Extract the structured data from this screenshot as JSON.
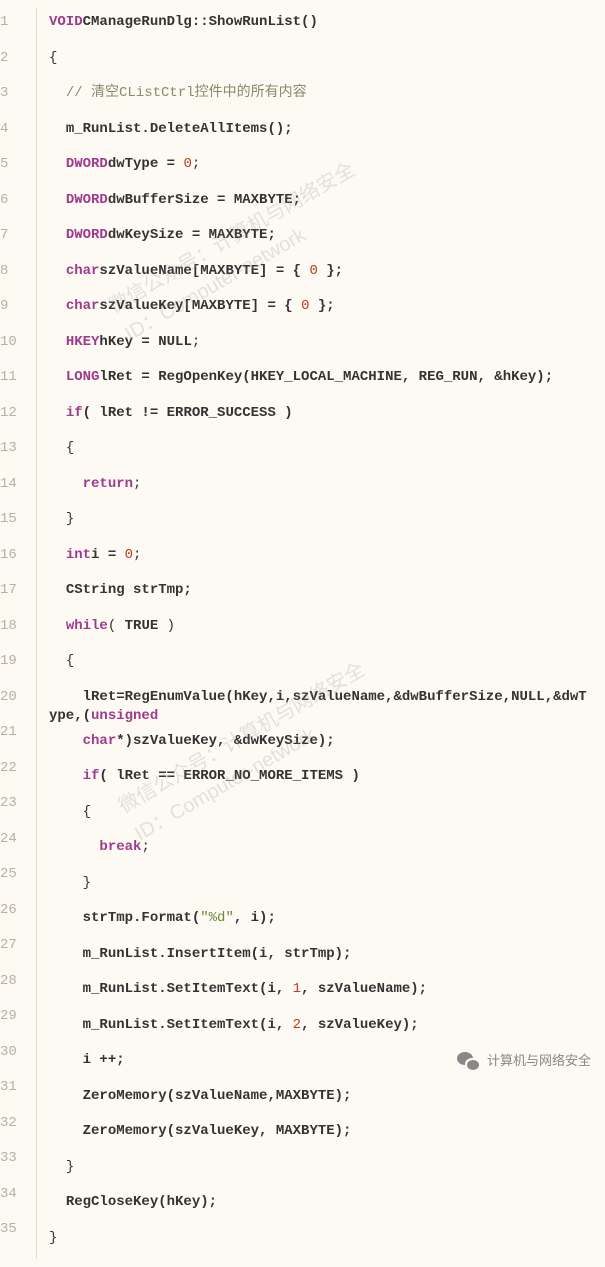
{
  "watermark": {
    "line1": "微信公众号：计算机与网络安全",
    "line2": "ID：Computer-network"
  },
  "footer": "计算机与网络安全",
  "code": {
    "lines": [
      {
        "n": "1",
        "indent": 0,
        "tokens": [
          {
            "t": "VOID",
            "c": "type"
          },
          {
            "t": "CManageRunDlg::ShowRunList()",
            "c": "ident"
          }
        ]
      },
      {
        "n": "2",
        "indent": 0,
        "tokens": [
          {
            "t": "{",
            "c": "punc"
          }
        ]
      },
      {
        "n": "3",
        "indent": 1,
        "tokens": [
          {
            "t": "// 清空CListCtrl控件中的所有内容",
            "c": "comment"
          }
        ]
      },
      {
        "n": "4",
        "indent": 1,
        "tokens": [
          {
            "t": "m_RunList.DeleteAllItems();",
            "c": "ident"
          }
        ]
      },
      {
        "n": "5",
        "indent": 1,
        "tokens": [
          {
            "t": "DWORD",
            "c": "type"
          },
          {
            "t": "dwType = ",
            "c": "ident"
          },
          {
            "t": "0",
            "c": "num"
          },
          {
            "t": ";",
            "c": "punc"
          }
        ]
      },
      {
        "n": "6",
        "indent": 1,
        "tokens": [
          {
            "t": "DWORD",
            "c": "type"
          },
          {
            "t": "dwBufferSize = MAXBYTE;",
            "c": "ident"
          }
        ]
      },
      {
        "n": "7",
        "indent": 1,
        "tokens": [
          {
            "t": "DWORD",
            "c": "type"
          },
          {
            "t": "dwKeySize = MAXBYTE;",
            "c": "ident"
          }
        ]
      },
      {
        "n": "8",
        "indent": 1,
        "tokens": [
          {
            "t": "char",
            "c": "type"
          },
          {
            "t": "szValueName[MAXBYTE] = { ",
            "c": "ident"
          },
          {
            "t": "0",
            "c": "num"
          },
          {
            "t": " };",
            "c": "ident"
          }
        ]
      },
      {
        "n": "9",
        "indent": 1,
        "tokens": [
          {
            "t": "char",
            "c": "type"
          },
          {
            "t": "szValueKey[MAXBYTE] = { ",
            "c": "ident"
          },
          {
            "t": "0",
            "c": "num"
          },
          {
            "t": " };",
            "c": "ident"
          }
        ]
      },
      {
        "n": "10",
        "indent": 1,
        "tokens": [
          {
            "t": "HKEY",
            "c": "type"
          },
          {
            "t": "hKey = ",
            "c": "ident"
          },
          {
            "t": "NULL",
            "c": "const"
          },
          {
            "t": ";",
            "c": "punc"
          }
        ]
      },
      {
        "n": "11",
        "indent": 1,
        "tokens": [
          {
            "t": "LONG",
            "c": "type"
          },
          {
            "t": "lRet = RegOpenKey(HKEY_LOCAL_MACHINE, REG_RUN, &hKey);",
            "c": "ident"
          }
        ]
      },
      {
        "n": "12",
        "indent": 1,
        "tokens": [
          {
            "t": "if",
            "c": "kw"
          },
          {
            "t": "( lRet != ERROR_SUCCESS )",
            "c": "ident"
          }
        ]
      },
      {
        "n": "13",
        "indent": 1,
        "tokens": [
          {
            "t": "{",
            "c": "punc"
          }
        ]
      },
      {
        "n": "14",
        "indent": 2,
        "tokens": [
          {
            "t": "return",
            "c": "kw"
          },
          {
            "t": ";",
            "c": "punc"
          }
        ]
      },
      {
        "n": "15",
        "indent": 1,
        "tokens": [
          {
            "t": "}",
            "c": "punc"
          }
        ]
      },
      {
        "n": "16",
        "indent": 1,
        "tokens": [
          {
            "t": "int",
            "c": "type"
          },
          {
            "t": "i = ",
            "c": "ident"
          },
          {
            "t": "0",
            "c": "num"
          },
          {
            "t": ";",
            "c": "punc"
          }
        ]
      },
      {
        "n": "17",
        "indent": 1,
        "tokens": [
          {
            "t": "CString strTmp;",
            "c": "ident"
          }
        ]
      },
      {
        "n": "18",
        "indent": 1,
        "tokens": [
          {
            "t": "while",
            "c": "kw"
          },
          {
            "t": "( ",
            "c": "punc"
          },
          {
            "t": "TRUE",
            "c": "const"
          },
          {
            "t": " )",
            "c": "punc"
          }
        ]
      },
      {
        "n": "19",
        "indent": 1,
        "tokens": [
          {
            "t": "{",
            "c": "punc"
          }
        ]
      },
      {
        "n": "20",
        "indent": 2,
        "tokens": [
          {
            "t": "lRet=RegEnumValue(hKey,i,szValueName,&dwBufferSize,",
            "c": "ident"
          },
          {
            "t": "NULL",
            "c": "const"
          },
          {
            "t": ",&dwType,(",
            "c": "ident"
          },
          {
            "t": "unsigned",
            "c": "type"
          }
        ]
      },
      {
        "n": "21",
        "indent": 2,
        "tokens": [
          {
            "t": "char",
            "c": "type"
          },
          {
            "t": "*)szValueKey, &dwKeySize);",
            "c": "ident"
          }
        ]
      },
      {
        "n": "22",
        "indent": 2,
        "tokens": [
          {
            "t": "if",
            "c": "kw"
          },
          {
            "t": "( lRet == ERROR_NO_MORE_ITEMS )",
            "c": "ident"
          }
        ]
      },
      {
        "n": "23",
        "indent": 2,
        "tokens": [
          {
            "t": "{",
            "c": "punc"
          }
        ]
      },
      {
        "n": "24",
        "indent": 3,
        "tokens": [
          {
            "t": "break",
            "c": "kw"
          },
          {
            "t": ";",
            "c": "punc"
          }
        ]
      },
      {
        "n": "25",
        "indent": 2,
        "tokens": [
          {
            "t": "}",
            "c": "punc"
          }
        ]
      },
      {
        "n": "26",
        "indent": 2,
        "tokens": [
          {
            "t": "strTmp.Format(",
            "c": "ident"
          },
          {
            "t": "\"%d\"",
            "c": "str"
          },
          {
            "t": ", i);",
            "c": "ident"
          }
        ]
      },
      {
        "n": "27",
        "indent": 2,
        "tokens": [
          {
            "t": "m_RunList.InsertItem(i, strTmp);",
            "c": "ident"
          }
        ]
      },
      {
        "n": "28",
        "indent": 2,
        "tokens": [
          {
            "t": "m_RunList.SetItemText(i, ",
            "c": "ident"
          },
          {
            "t": "1",
            "c": "num"
          },
          {
            "t": ", szValueName);",
            "c": "ident"
          }
        ]
      },
      {
        "n": "29",
        "indent": 2,
        "tokens": [
          {
            "t": "m_RunList.SetItemText(i, ",
            "c": "ident"
          },
          {
            "t": "2",
            "c": "num"
          },
          {
            "t": ", szValueKey);",
            "c": "ident"
          }
        ]
      },
      {
        "n": "30",
        "indent": 2,
        "tokens": [
          {
            "t": "i ++;",
            "c": "ident"
          }
        ]
      },
      {
        "n": "31",
        "indent": 2,
        "tokens": [
          {
            "t": "ZeroMemory(szValueName,MAXBYTE);",
            "c": "ident"
          }
        ]
      },
      {
        "n": "32",
        "indent": 2,
        "tokens": [
          {
            "t": "ZeroMemory(szValueKey, MAXBYTE);",
            "c": "ident"
          }
        ]
      },
      {
        "n": "33",
        "indent": 1,
        "tokens": [
          {
            "t": "}",
            "c": "punc"
          }
        ]
      },
      {
        "n": "34",
        "indent": 1,
        "tokens": [
          {
            "t": "RegCloseKey(hKey);",
            "c": "ident"
          }
        ]
      },
      {
        "n": "35",
        "indent": 0,
        "tokens": [
          {
            "t": "}",
            "c": "punc"
          }
        ]
      }
    ]
  }
}
